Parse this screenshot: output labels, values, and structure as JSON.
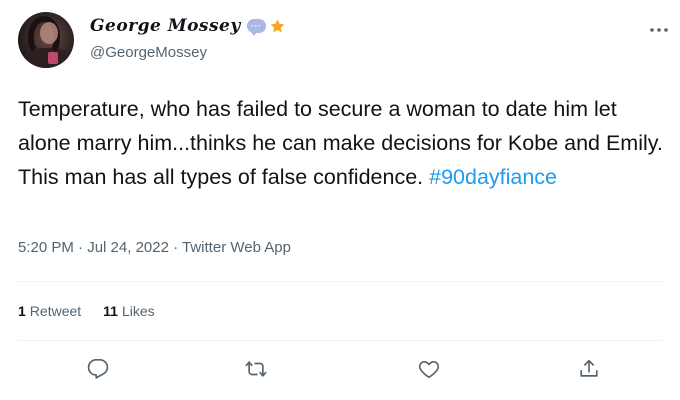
{
  "author": {
    "display_name": "George Mossey",
    "handle": "@GeorgeMossey",
    "bubble_badge_text": "···",
    "badges": [
      "speech-bubble-icon",
      "star-icon"
    ]
  },
  "tweet": {
    "text": "Temperature, who has failed to secure a woman to date him let alone marry him...thinks he can make decisions for Kobe and Emily. This man has all types of false confidence. ",
    "hashtag": "#90dayfiance",
    "time": "5:20 PM",
    "separator": " · ",
    "date": "Jul 24, 2022",
    "source": "Twitter Web App"
  },
  "stats": {
    "retweets_count": "1",
    "retweets_label": "Retweet",
    "likes_count": "11",
    "likes_label": "Likes"
  },
  "actions": [
    "reply-icon",
    "retweet-icon",
    "like-icon",
    "share-icon"
  ],
  "colors": {
    "text": "#0f1419",
    "secondary": "#536471",
    "accent": "#1d9bf0",
    "divider": "#eff3f4",
    "star": "#f5a623"
  }
}
